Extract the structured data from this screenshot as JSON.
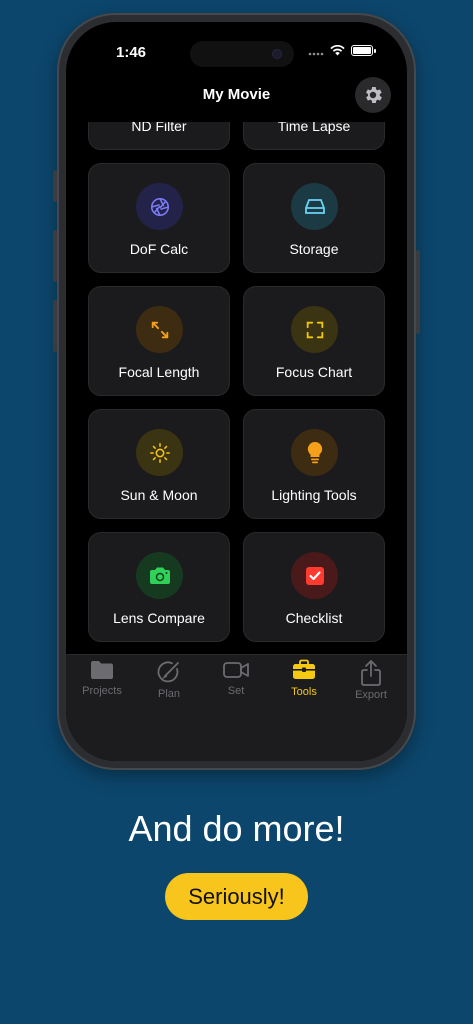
{
  "status_bar": {
    "time": "1:46"
  },
  "nav": {
    "title": "My Movie",
    "settings_icon": "gear-icon"
  },
  "tiles": [
    {
      "label": "ND Filter",
      "icon": "nd-filter-icon"
    },
    {
      "label": "Time Lapse",
      "icon": "time-lapse-icon"
    },
    {
      "label": "DoF Calc",
      "icon": "aperture-icon",
      "accent": "#7a7cf5",
      "bg": "#23234a"
    },
    {
      "label": "Storage",
      "icon": "storage-icon",
      "accent": "#6ad3f3",
      "bg": "#1b3a44"
    },
    {
      "label": "Focal Length",
      "icon": "expand-arrows-icon",
      "accent": "#f4a01a",
      "bg": "#3e2c12"
    },
    {
      "label": "Focus Chart",
      "icon": "focus-frame-icon",
      "accent": "#f2c60d",
      "bg": "#3b3412"
    },
    {
      "label": "Sun & Moon",
      "icon": "sun-icon",
      "accent": "#f5c60f",
      "bg": "#3b3412"
    },
    {
      "label": "Lighting Tools",
      "icon": "lightbulb-icon",
      "accent": "#f4a01a",
      "bg": "#3e2c12"
    },
    {
      "label": "Lens Compare",
      "icon": "camera-icon",
      "accent": "#2fd158",
      "bg": "#163a20"
    },
    {
      "label": "Checklist",
      "icon": "checkbox-icon",
      "accent": "#ff3b30",
      "bg": "#4a1a1a"
    }
  ],
  "tab_bar": {
    "tabs": [
      {
        "label": "Projects",
        "icon": "folder-icon",
        "active": false
      },
      {
        "label": "Plan",
        "icon": "pencil-circle-icon",
        "active": false
      },
      {
        "label": "Set",
        "icon": "video-camera-icon",
        "active": false
      },
      {
        "label": "Tools",
        "icon": "toolbox-icon",
        "active": true
      },
      {
        "label": "Export",
        "icon": "share-icon",
        "active": false
      }
    ],
    "active_color": "#f5c90f",
    "inactive_color": "#6b6b70"
  },
  "promo": {
    "headline": "And do more!",
    "button_label": "Seriously!"
  },
  "colors": {
    "background": "#0c466c",
    "button": "#f7c51c"
  }
}
